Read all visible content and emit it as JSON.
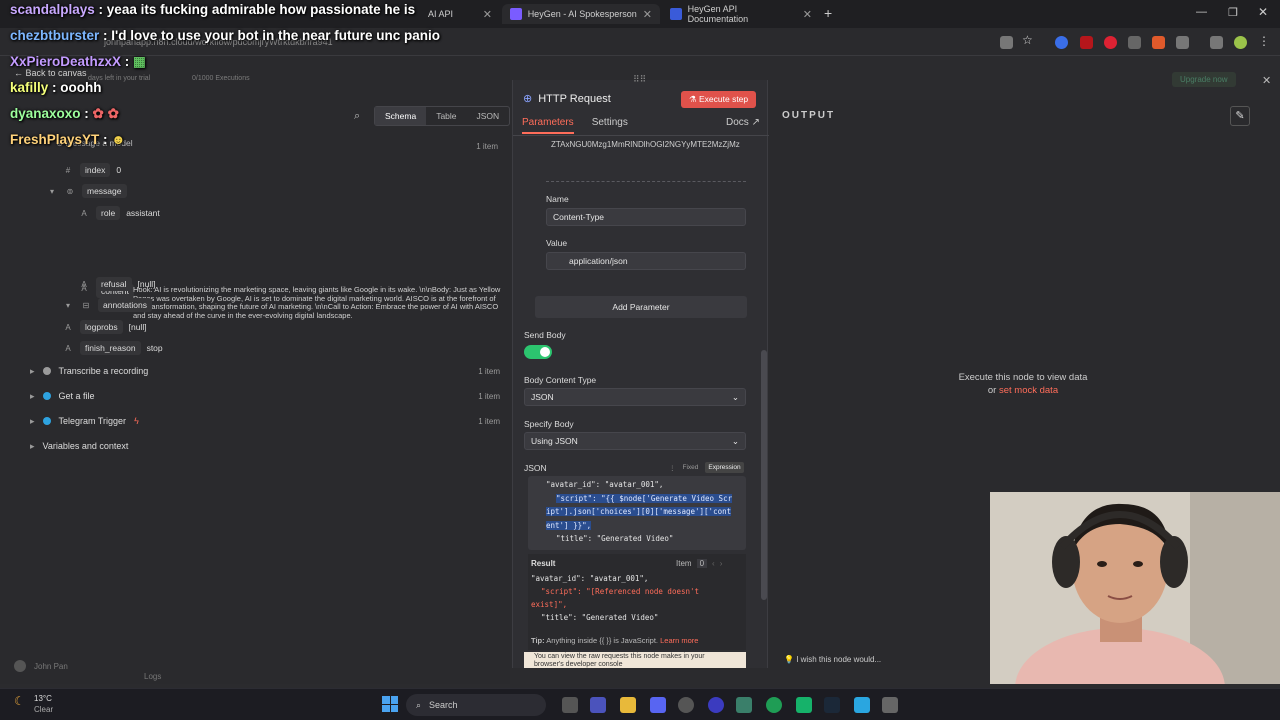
{
  "browser": {
    "tabs": [
      {
        "label": "AI API",
        "active": false
      },
      {
        "label": "HeyGen - AI Spokesperson Vid",
        "active": false
      },
      {
        "label": "HeyGen API Documentation",
        "active": true
      }
    ],
    "new_tab": "+",
    "url": "johnpanapp.n8n.cloud/workflow/pdcomjryWtrktdkb/fra941"
  },
  "chat": [
    {
      "user": "scandalplays",
      "text": "yeaa its fucking admirable how passionate he is"
    },
    {
      "user": "chezbtburster",
      "text": "I'd love to use your bot in the near future unc panio"
    },
    {
      "user": "XxPieroDeathzxX",
      "text": ""
    },
    {
      "user": "kafilly",
      "text": "ooohh"
    },
    {
      "user": "dyanaxoxo",
      "text": ""
    },
    {
      "user": "FreshPlaysYT",
      "text": ""
    }
  ],
  "app": {
    "back_label": "Back to canvas",
    "trial_text": "days left in your trial",
    "executions": "0/1000 Executions",
    "upgrade_label": "Upgrade now",
    "view_tabs": [
      "Schema",
      "Table",
      "JSON"
    ],
    "active_view": "Schema",
    "message_node": "Message a model",
    "items_count": "1 item",
    "tree": {
      "index_key": "index",
      "index_val": "0",
      "message_key": "message",
      "role_key": "role",
      "role_val": "assistant",
      "content_key": "content",
      "content_val": "Hook: AI is revolutionizing the marketing space, leaving giants like Google in its wake. \\n\\nBody: Just as Yellow Pages was overtaken by Google, AI is set to dominate the digital marketing world. AISCO is at the forefront of this transformation, shaping the future of AI marketing. \\n\\nCall to Action: Embrace the power of AI with AISCO and stay ahead of the curve in the ever-evolving digital landscape.",
      "refusal_key": "refusal",
      "refusal_val": "[null]",
      "annotations_key": "annotations",
      "logprobs_key": "logprobs",
      "logprobs_val": "[null]",
      "finish_key": "finish_reason",
      "finish_val": "stop"
    },
    "nodes": [
      {
        "label": "Transcribe a recording",
        "count": "1 item"
      },
      {
        "label": "Get a file",
        "count": "1 item"
      },
      {
        "label": "Telegram Trigger",
        "count": "1 item"
      }
    ],
    "variables_label": "Variables and context",
    "user_name": "John Pan",
    "logs_label": "Logs"
  },
  "modal": {
    "title": "HTTP Request",
    "execute_label": "Execute step",
    "tabs": [
      "Parameters",
      "Settings"
    ],
    "docs_label": "Docs",
    "token_value": "ZTAxNGU0Mzg1MmRlNDlhOGI2NGYyMTE2MzZjMz",
    "name_label": "Name",
    "name_value": "Content-Type",
    "value_label": "Value",
    "value_value": "application/json",
    "add_param_label": "Add Parameter",
    "send_body_label": "Send Body",
    "send_body_on": true,
    "body_type_label": "Body Content Type",
    "body_type_value": "JSON",
    "specify_label": "Specify Body",
    "specify_value": "Using JSON",
    "json_label": "JSON",
    "fixed_label": "Fixed",
    "expression_label": "Expression",
    "json_lines": [
      "\"avatar_id\": \"avatar_001\",",
      "\"script\": \"{{ $node['Generate Video Scr",
      "ipt'].json['choices'][0]['message']['cont",
      "ent'] }}\",",
      "\"title\": \"Generated Video\""
    ],
    "result_label": "Result",
    "item_label": "Item",
    "item_value": "0",
    "result_lines": [
      "\"avatar_id\": \"avatar_001\",",
      "\"script\": \"[Referenced node doesn't",
      "exist]\",",
      "\"title\": \"Generated Video\""
    ],
    "tip_prefix": "Tip:",
    "tip_text": "Anything inside {{ }} is JavaScript.",
    "learn_more": "Learn more",
    "warning_text": "You can view the raw requests this node makes in your browser's developer console"
  },
  "output": {
    "title": "OUTPUT",
    "execute_text": "Execute this node to view data",
    "or_text": "or",
    "mock_link": "set mock data",
    "wish_text": "I wish this node would..."
  },
  "taskbar": {
    "weather_temp": "13°C",
    "weather_desc": "Clear",
    "search_label": "Search"
  }
}
